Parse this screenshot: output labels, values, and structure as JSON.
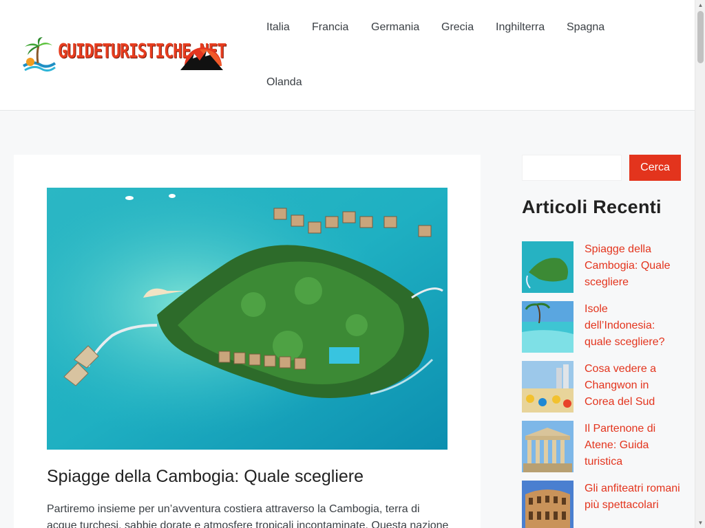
{
  "header": {
    "logo_text": "GUIDETURISTICHE.NET",
    "nav": [
      "Italia",
      "Francia",
      "Germania",
      "Grecia",
      "Inghilterra",
      "Spagna",
      "Olanda"
    ]
  },
  "article": {
    "title": "Spiagge della Cambogia: Quale scegliere",
    "excerpt": "Partiremo insieme per un’avventura costiera attraverso la Cambogia, terra di acque turchesi, sabbie dorate e atmosfere tropicali incontaminate. Questa nazione"
  },
  "sidebar": {
    "search": {
      "placeholder": "",
      "button_label": "Cerca"
    },
    "widget_title": "Articoli Recenti",
    "recent": [
      {
        "title": "Spiagge della Cambogia: Quale scegliere"
      },
      {
        "title": "Isole dell’Indonesia: quale scegliere?"
      },
      {
        "title": "Cosa vedere a Changwon in Corea del Sud"
      },
      {
        "title": "Il Partenone di Atene: Guida turistica"
      },
      {
        "title": "Gli anfiteatri romani più spettacolari"
      }
    ]
  },
  "colors": {
    "accent": "#e3341d",
    "background": "#f7f8f9",
    "nav_text": "#3a3f44"
  }
}
